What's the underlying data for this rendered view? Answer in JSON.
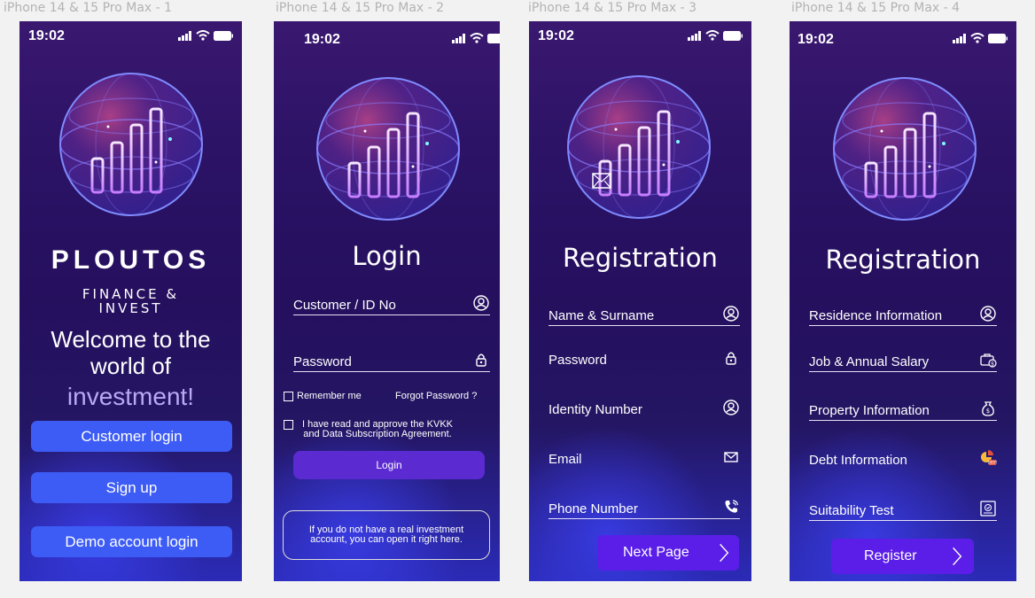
{
  "frames": [
    {
      "title": "iPhone 14 & 15 Pro Max - 1"
    },
    {
      "title": "iPhone 14 & 15 Pro Max - 2"
    },
    {
      "title": "iPhone 14 & 15 Pro Max - 3"
    },
    {
      "title": "iPhone 14 & 15 Pro Max - 4"
    }
  ],
  "status_bar": {
    "time": "19:02"
  },
  "splash": {
    "brand": "PLOUTOS",
    "brand_sub_line1": "FINANCE &",
    "brand_sub_line2": "INVEST",
    "welcome_line1": "Welcome to the",
    "welcome_line2": "world of",
    "welcome_accent": "investment!",
    "buttons": {
      "customer_login": "Customer login",
      "sign_up": "Sign up",
      "demo_login": "Demo account login"
    }
  },
  "login": {
    "title": "Login",
    "customer_id_label": "Customer / ID No",
    "password_label": "Password",
    "remember_me": "Remember me",
    "forgot_password": "Forgot Password ?",
    "agreement_line1": "I have read and approve the KVKK",
    "agreement_line2": "and Data Subscription Agreement.",
    "login_button": "Login",
    "info_text": "If you do not have a real investment account, you can open it right here."
  },
  "registration1": {
    "title": "Registration",
    "fields": {
      "name": "Name & Surname",
      "password": "Password",
      "identity": "Identity Number",
      "email": "Email",
      "phone": "Phone Number"
    },
    "next_button": "Next Page"
  },
  "registration2": {
    "title": "Registration",
    "fields": {
      "residence": "Residence Information",
      "job": "Job & Annual Salary",
      "property": "Property Information",
      "debt": "Debt Information",
      "suitability": "Suitability Test"
    },
    "register_button": "Register"
  },
  "colors": {
    "accent_blue": "#3d5cf5",
    "accent_purple": "#5a1ee8",
    "accent_lilac": "#b9a8f2"
  }
}
